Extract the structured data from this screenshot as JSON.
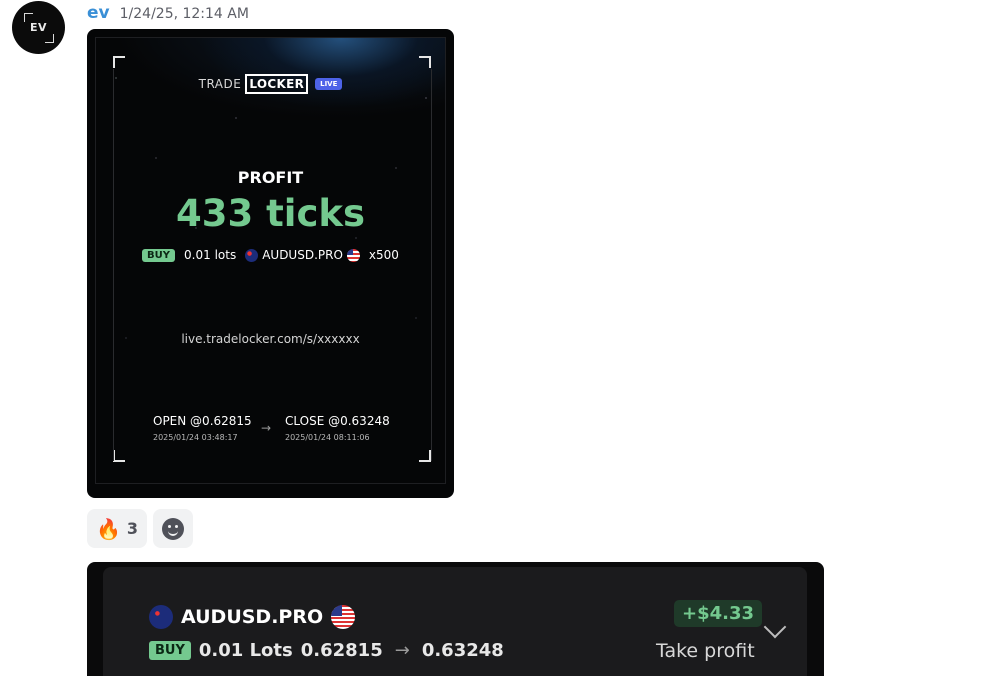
{
  "avatar": {
    "text": "EV",
    "icon": "ev-logo-icon"
  },
  "message": {
    "username": "ev",
    "timestamp": "1/24/25, 12:14 AM"
  },
  "share_card": {
    "brand_trade": "TRADE",
    "brand_locker": "LOCKER",
    "brand_live": "LIVE",
    "profit_label": "PROFIT",
    "profit_value": "433 ticks",
    "side": "BUY",
    "lots": "0.01 lots",
    "pair": "AUDUSD.PRO",
    "leverage": "x500",
    "link": "live.tradelocker.com/s/xxxxxx",
    "open_label": "OPEN @0.62815",
    "open_time": "2025/01/24 03:48:17",
    "close_label": "CLOSE @0.63248",
    "close_time": "2025/01/24 08:11:06",
    "arrow": "→",
    "accent_color": "#74c98f",
    "live_color": "#4d63e8"
  },
  "reactions": [
    {
      "emoji": "🔥",
      "count": "3"
    },
    {
      "icon": "add-reaction-icon"
    }
  ],
  "trade_card": {
    "pair": "AUDUSD.PRO",
    "pnl": "+$4.33",
    "side": "BUY",
    "lots": "0.01 Lots",
    "open_price": "0.62815",
    "arrow": "→",
    "close_price": "0.63248",
    "close_reason": "Take profit",
    "expand_icon": "chevron-down-icon"
  }
}
